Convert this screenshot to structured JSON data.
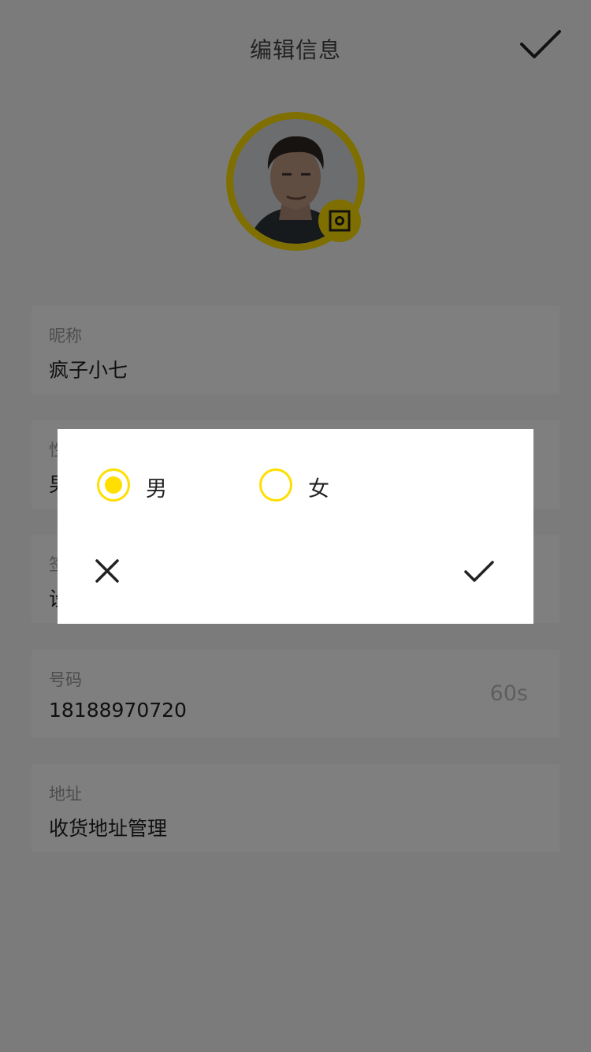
{
  "header": {
    "title": "编辑信息",
    "confirm_icon": "check-icon"
  },
  "profile": {
    "avatar_ring_color": "#ffdf00",
    "camera_icon": "camera-icon"
  },
  "fields": {
    "nickname": {
      "label": "昵称",
      "value": "疯子小七"
    },
    "gender": {
      "label": "性别",
      "value": "男"
    },
    "signature": {
      "label": "签名",
      "value": "设"
    },
    "phone": {
      "label": "号码",
      "value": "18188970720",
      "countdown": "60s"
    },
    "address": {
      "label": "地址",
      "value": "收货地址管理"
    }
  },
  "gender_dialog": {
    "options": [
      {
        "label": "男",
        "selected": true
      },
      {
        "label": "女",
        "selected": false
      }
    ],
    "cancel_icon": "close-icon",
    "confirm_icon": "check-icon",
    "accent": "#ffdf00"
  }
}
